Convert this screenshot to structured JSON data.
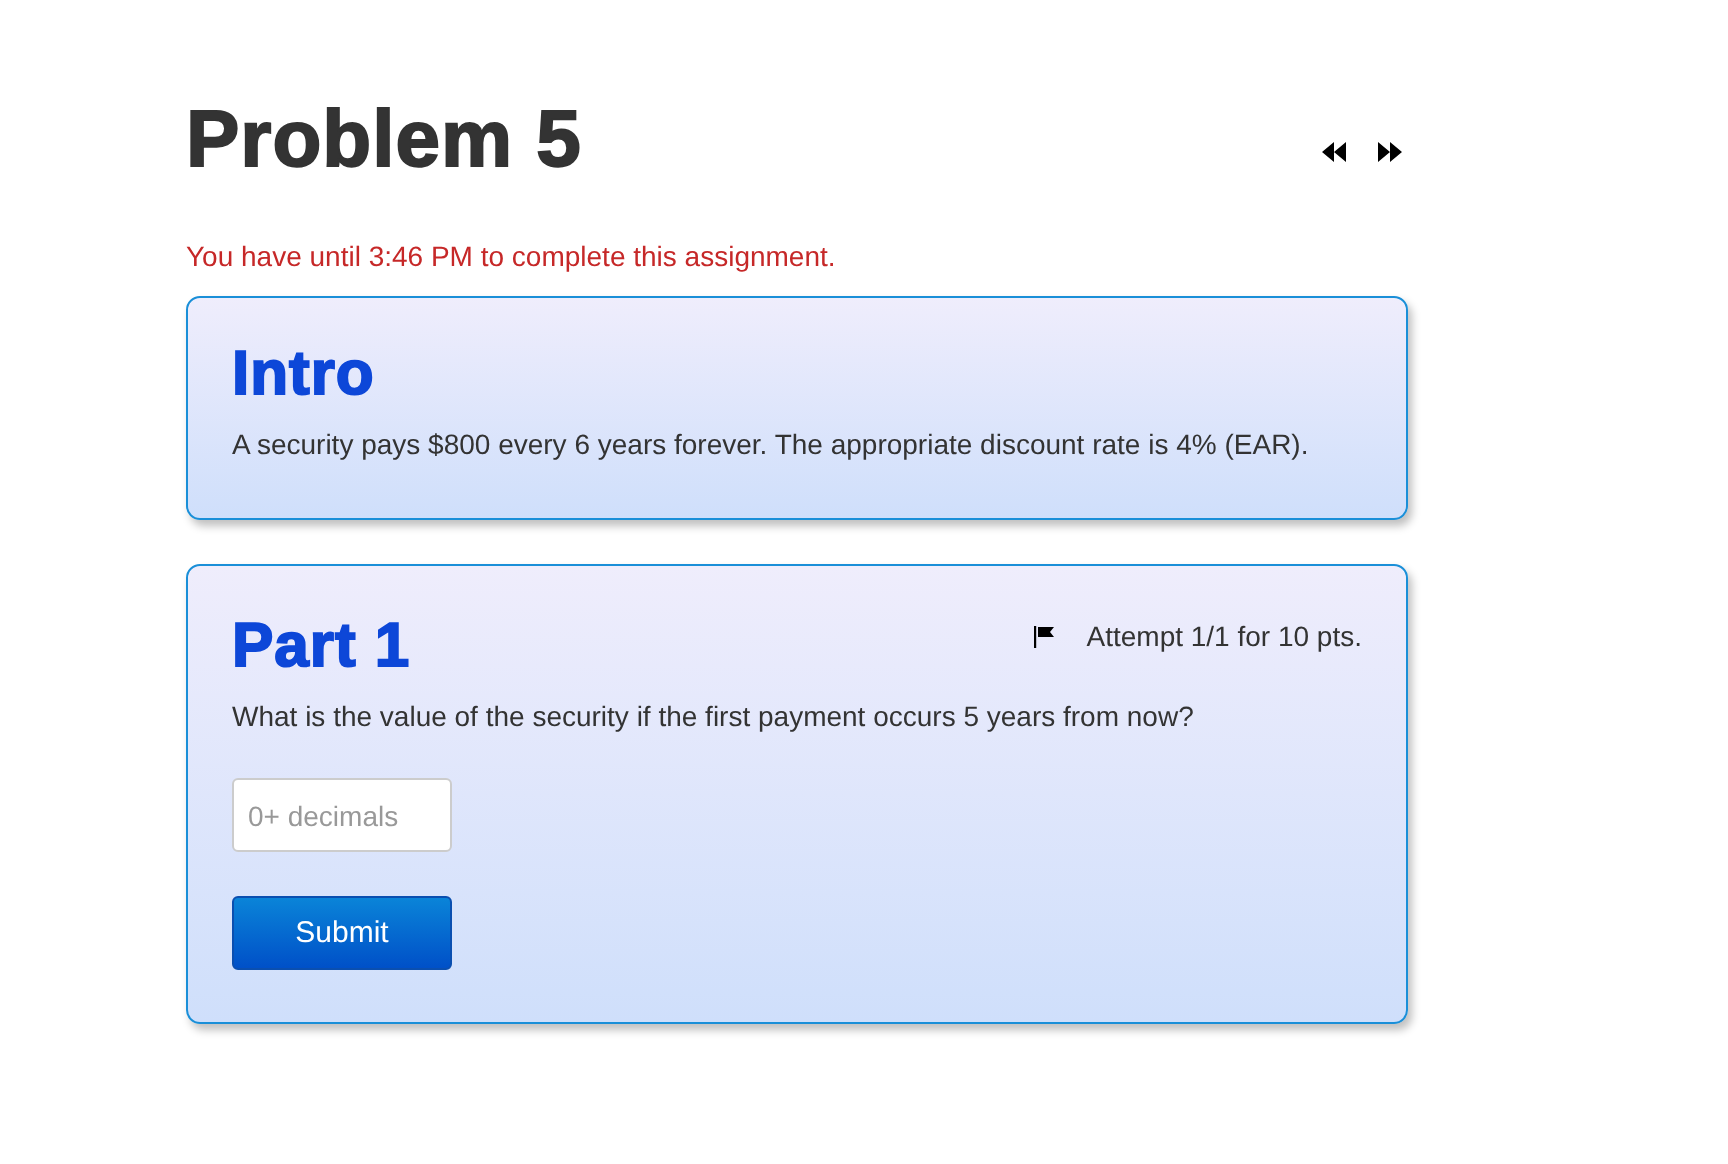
{
  "title": "Problem 5",
  "deadline": "You have until 3:46 PM to complete this assignment.",
  "intro": {
    "heading": "Intro",
    "text": "A security pays $800 every 6 years forever. The appropriate discount rate is 4% (EAR)."
  },
  "parts": [
    {
      "heading": "Part 1",
      "attempt": "Attempt 1/1 for 10 pts.",
      "question": "What is the value of the security if the first payment occurs 5 years from now?",
      "answer": {
        "placeholder": "0+ decimals"
      },
      "submit": "Submit"
    }
  ]
}
